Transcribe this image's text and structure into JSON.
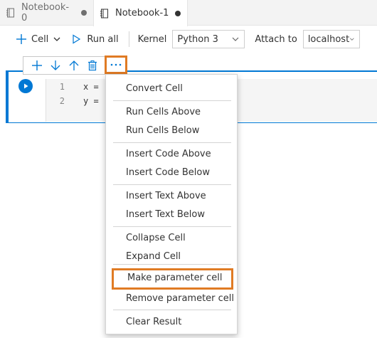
{
  "tabs": [
    {
      "label": "Notebook-0",
      "active": false
    },
    {
      "label": "Notebook-1",
      "active": true
    }
  ],
  "toolbar": {
    "cell_label": "Cell",
    "run_all_label": "Run all",
    "kernel_label": "Kernel",
    "kernel_value": "Python 3",
    "attach_label": "Attach to",
    "attach_value": "localhost"
  },
  "cell": {
    "lines": [
      {
        "num": "1",
        "code": "x = "
      },
      {
        "num": "2",
        "code": "y = "
      }
    ]
  },
  "menu": {
    "items": [
      "Convert Cell",
      "Run Cells Above",
      "Run Cells Below",
      "Insert Code Above",
      "Insert Code Below",
      "Insert Text Above",
      "Insert Text Below",
      "Collapse Cell",
      "Expand Cell",
      "Make parameter cell",
      "Remove parameter cell",
      "Clear Result"
    ]
  },
  "colors": {
    "accent": "#0078d4",
    "highlight": "#e07b24"
  }
}
